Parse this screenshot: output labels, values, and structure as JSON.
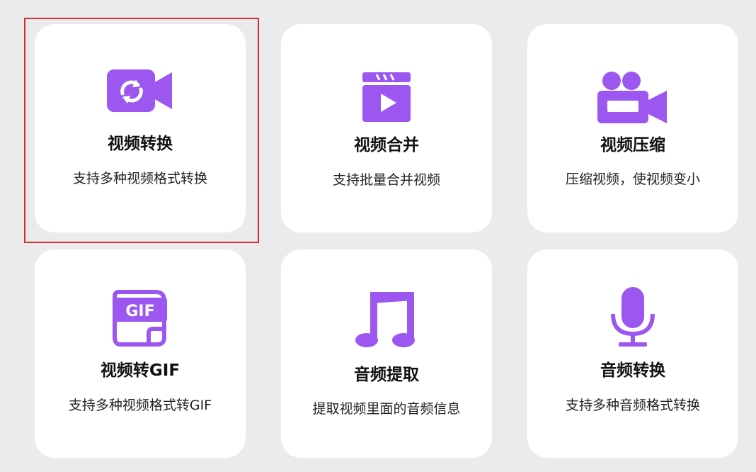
{
  "colors": {
    "background": "#ebebee",
    "card": "#ffffff",
    "accent": "#9b57f0",
    "selection": "#e02b2b"
  },
  "tools": [
    {
      "icon": "video-convert-icon",
      "title": "视频转换",
      "description": "支持多种视频格式转换",
      "selected": true
    },
    {
      "icon": "video-merge-icon",
      "title": "视频合并",
      "description": "支持批量合并视频",
      "selected": false
    },
    {
      "icon": "video-compress-icon",
      "title": "视频压缩",
      "description": "压缩视频，使视频变小",
      "selected": false
    },
    {
      "icon": "gif-icon",
      "title": "视频转GIF",
      "description": "支持多种视频格式转GIF",
      "selected": false
    },
    {
      "icon": "music-note-icon",
      "title": "音频提取",
      "description": "提取视频里面的音频信息",
      "selected": false
    },
    {
      "icon": "microphone-icon",
      "title": "音频转换",
      "description": "支持多种音频格式转换",
      "selected": false
    }
  ]
}
